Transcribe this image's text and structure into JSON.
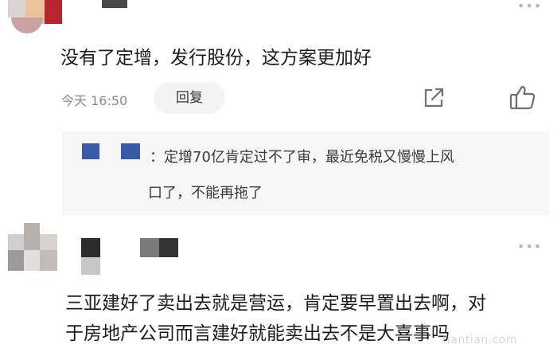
{
  "comment1": {
    "text": "没有了定增，发行股份，这方案更加好",
    "time": "今天 16:50",
    "reply_label": "回复"
  },
  "reply": {
    "line1": "：定增70亿肯定过不了审，最近免税又慢慢上风",
    "line2": "口了，不能再拖了"
  },
  "comment2": {
    "line1": "三亚建好了卖出去就是营运，肯定要早置出去啊，对",
    "line2": "于房地产公司而言建好就能卖出去不是大喜事吗"
  },
  "watermark": "tiantian.com",
  "icons": {
    "more": "more-icon",
    "share": "share-icon",
    "like": "thumbs-up-icon"
  },
  "colors": {
    "reply_bg": "#f6f6f6",
    "pill_bg": "#f4f4f4",
    "meta_gray": "#8a8a8a",
    "mosaic_blue": "#3a5aa8"
  }
}
